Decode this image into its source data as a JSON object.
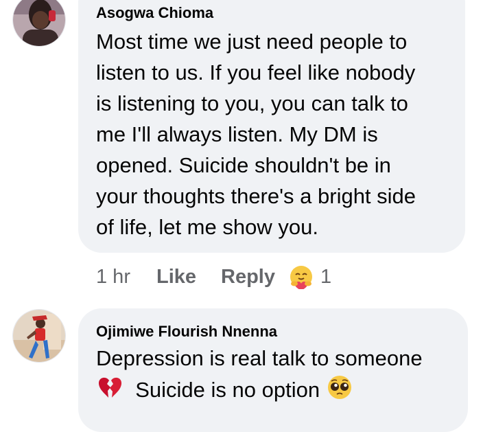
{
  "comments": [
    {
      "author": "Asogwa Chioma",
      "avatar_icon": "profile-photo-avatar",
      "lines": [
        "Most time we just need people to",
        "listen to us. If you feel like nobody",
        "is listening to you, you can talk to",
        "me I'll always listen. My DM is",
        "opened. Suicide shouldn't be in",
        "your thoughts there's a bright side",
        "of life, let me show you."
      ],
      "actions": {
        "time": "1 hr",
        "like_label": "Like",
        "reply_label": "Reply",
        "reaction_icon": "care-reaction-icon",
        "reaction_count": "1"
      }
    },
    {
      "author": "Ojimiwe Flourish Nnenna",
      "avatar_icon": "profile-photo-avatar",
      "line1": "Depression is real talk to someone",
      "line2_prefix_icon": "broken-heart-icon",
      "line2_text": "Suicide is no option",
      "line2_suffix_icon": "pleading-face-icon"
    }
  ],
  "colors": {
    "bubble": "#f0f2f5",
    "text": "#050505",
    "muted": "#65676b"
  }
}
